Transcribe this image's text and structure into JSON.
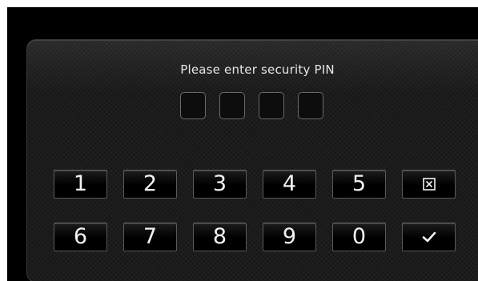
{
  "prompt": "Please enter security PIN",
  "pin": {
    "length": 4,
    "entered": [
      "",
      "",
      "",
      ""
    ]
  },
  "keypad": {
    "row1": [
      "1",
      "2",
      "3",
      "4",
      "5"
    ],
    "row2": [
      "6",
      "7",
      "8",
      "9",
      "0"
    ],
    "clear_icon": "clear-x-box-icon",
    "confirm_icon": "checkmark-icon"
  },
  "colors": {
    "background": "#000000",
    "panel": "#1b1b1b",
    "text": "#e6e6e6",
    "key_border": "#5a5a5a"
  }
}
